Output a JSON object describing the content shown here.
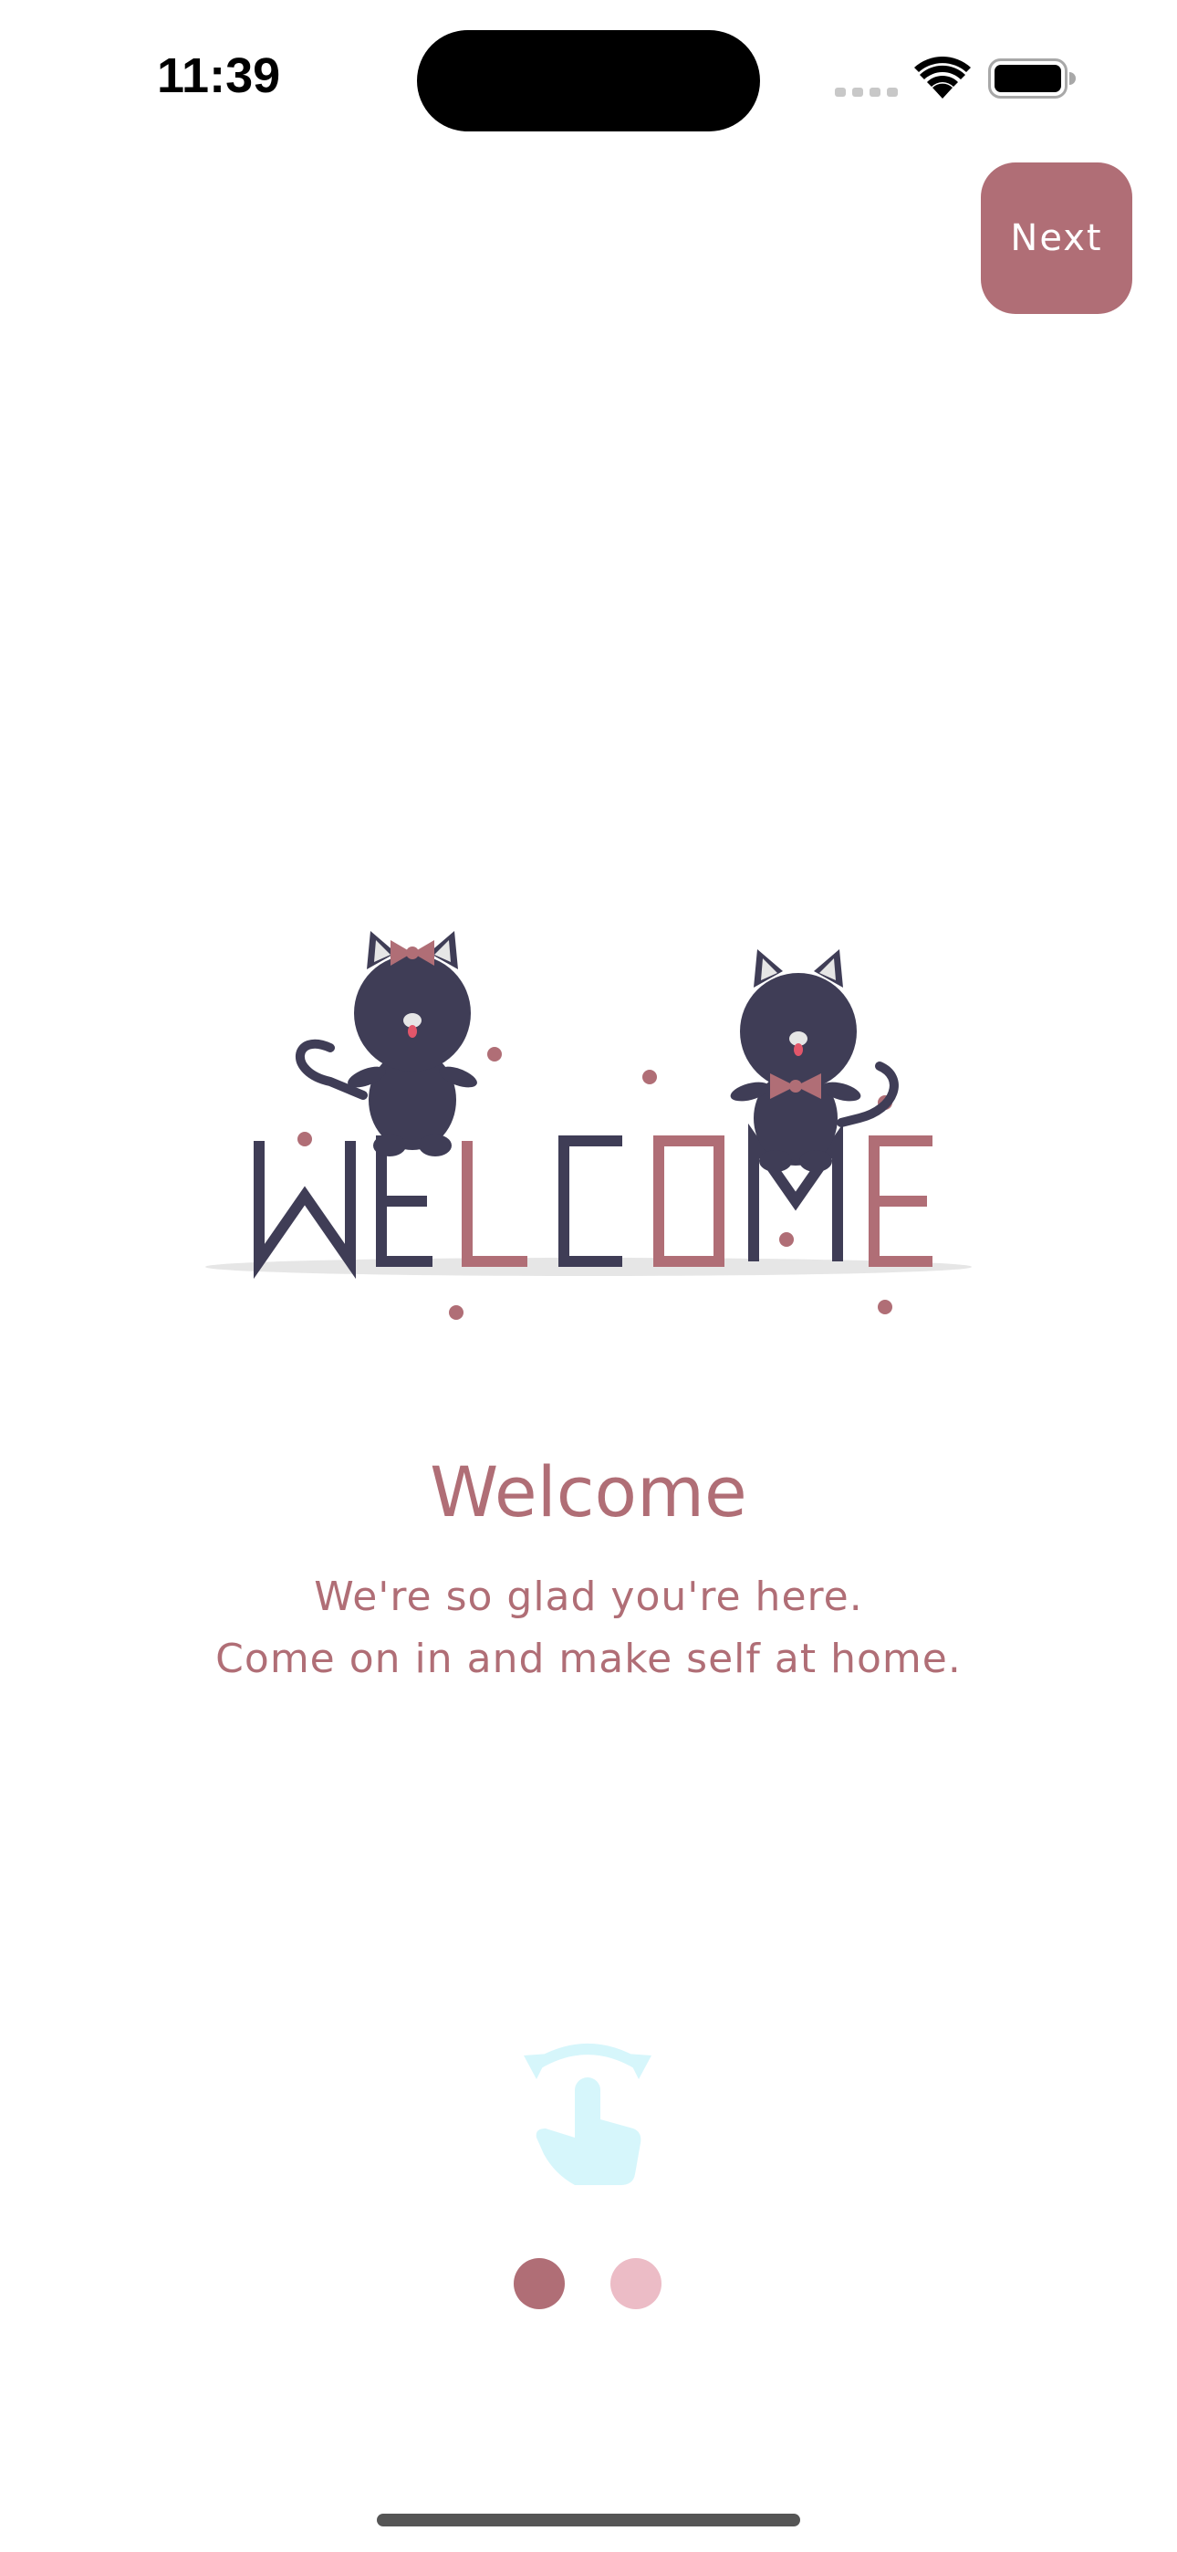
{
  "status_bar": {
    "time": "11:39",
    "icons": [
      "cellular-signal-icon",
      "wifi-icon",
      "battery-icon"
    ]
  },
  "toolbar": {
    "next_label": "Next"
  },
  "illustration": {
    "subject": "welcome-cats-illustration",
    "letters": [
      "W",
      "E",
      "L",
      "C",
      "O",
      "M",
      "E"
    ]
  },
  "onboarding": {
    "title": "Welcome",
    "line1": "We're so glad you're here.",
    "line2": "Come on in and make self at home.",
    "swipe_icon": "swipe-gesture-icon"
  },
  "pagination": {
    "current_page": 1,
    "total_pages": 2
  },
  "colors": {
    "accent": "#b06e76",
    "accent_light": "#ecbcc6",
    "cat": "#3f3d56",
    "swipe_hint": "#d6f6fb"
  }
}
